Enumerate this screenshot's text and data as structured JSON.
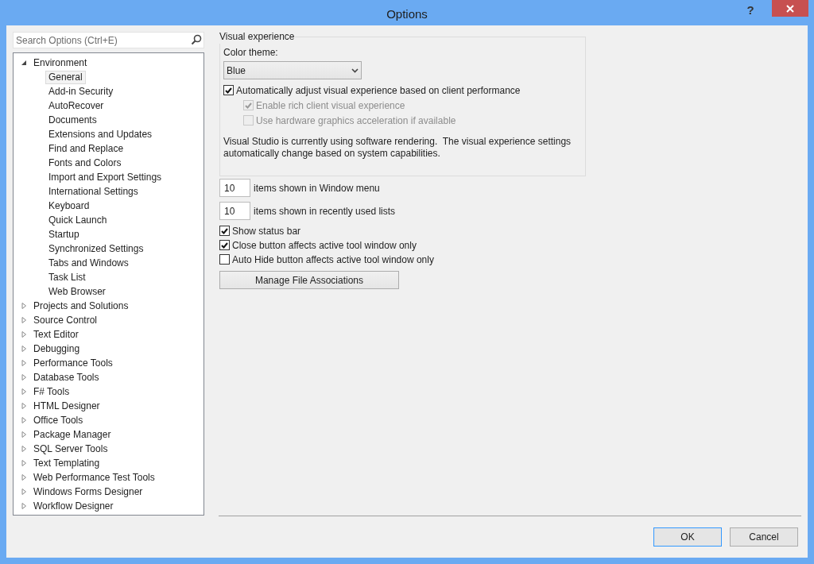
{
  "window": {
    "title": "Options",
    "help": "?"
  },
  "search": {
    "placeholder": "Search Options (Ctrl+E)"
  },
  "tree": [
    {
      "label": "Environment",
      "expanded": true,
      "selected": false,
      "children": [
        {
          "label": "General",
          "selected": true
        },
        {
          "label": "Add-in Security",
          "selected": false
        },
        {
          "label": "AutoRecover",
          "selected": false
        },
        {
          "label": "Documents",
          "selected": false
        },
        {
          "label": "Extensions and Updates",
          "selected": false
        },
        {
          "label": "Find and Replace",
          "selected": false
        },
        {
          "label": "Fonts and Colors",
          "selected": false
        },
        {
          "label": "Import and Export Settings",
          "selected": false
        },
        {
          "label": "International Settings",
          "selected": false
        },
        {
          "label": "Keyboard",
          "selected": false
        },
        {
          "label": "Quick Launch",
          "selected": false
        },
        {
          "label": "Startup",
          "selected": false
        },
        {
          "label": "Synchronized Settings",
          "selected": false
        },
        {
          "label": "Tabs and Windows",
          "selected": false
        },
        {
          "label": "Task List",
          "selected": false
        },
        {
          "label": "Web Browser",
          "selected": false
        }
      ]
    },
    {
      "label": "Projects and Solutions",
      "expanded": false,
      "selected": false
    },
    {
      "label": "Source Control",
      "expanded": false,
      "selected": false
    },
    {
      "label": "Text Editor",
      "expanded": false,
      "selected": false
    },
    {
      "label": "Debugging",
      "expanded": false,
      "selected": false
    },
    {
      "label": "Performance Tools",
      "expanded": false,
      "selected": false
    },
    {
      "label": "Database Tools",
      "expanded": false,
      "selected": false
    },
    {
      "label": "F# Tools",
      "expanded": false,
      "selected": false
    },
    {
      "label": "HTML Designer",
      "expanded": false,
      "selected": false
    },
    {
      "label": "Office Tools",
      "expanded": false,
      "selected": false
    },
    {
      "label": "Package Manager",
      "expanded": false,
      "selected": false
    },
    {
      "label": "SQL Server Tools",
      "expanded": false,
      "selected": false
    },
    {
      "label": "Text Templating",
      "expanded": false,
      "selected": false
    },
    {
      "label": "Web Performance Test Tools",
      "expanded": false,
      "selected": false
    },
    {
      "label": "Windows Forms Designer",
      "expanded": false,
      "selected": false
    },
    {
      "label": "Workflow Designer",
      "expanded": false,
      "selected": false
    }
  ],
  "visual_experience": {
    "legend": "Visual experience",
    "color_theme_label": "Color theme:",
    "color_theme_value": "Blue",
    "options": [
      {
        "label": "Automatically adjust visual experience based on client performance",
        "checked": true,
        "disabled": false,
        "indented": false
      },
      {
        "label": "Enable rich client visual experience",
        "checked": true,
        "disabled": true,
        "indented": true
      },
      {
        "label": "Use hardware graphics acceleration if available",
        "checked": false,
        "disabled": true,
        "indented": true
      }
    ],
    "note": "Visual Studio is currently using software rendering.  The visual experience settings automatically change based on system capabilities."
  },
  "number_fields": [
    {
      "value": "10",
      "label": "items shown in Window menu"
    },
    {
      "value": "10",
      "label": "items shown in recently used lists"
    }
  ],
  "checkboxes": [
    {
      "label": "Show status bar",
      "checked": true
    },
    {
      "label": "Close button affects active tool window only",
      "checked": true
    },
    {
      "label": "Auto Hide button affects active tool window only",
      "checked": false
    }
  ],
  "manage_button": "Manage File Associations",
  "footer_buttons": [
    {
      "label": "OK",
      "default": true
    },
    {
      "label": "Cancel",
      "default": false
    }
  ]
}
